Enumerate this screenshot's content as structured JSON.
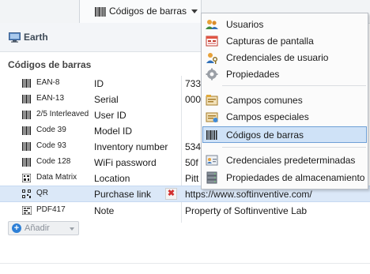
{
  "tab": {
    "label": "Códigos de barras"
  },
  "left_panel": {
    "computer_name": "Earth",
    "grid_title": "Códigos de barras",
    "add_button_label": "Añadir",
    "rows": [
      {
        "type": "EAN-8",
        "name": "ID",
        "value": "733",
        "selected": false
      },
      {
        "type": "EAN-13",
        "name": "Serial",
        "value": "000",
        "selected": false
      },
      {
        "type": "2/5 Interleaved",
        "name": "User ID",
        "value": "",
        "selected": false
      },
      {
        "type": "Code 39",
        "name": "Model ID",
        "value": "",
        "selected": false
      },
      {
        "type": "Code 93",
        "name": "Inventory number",
        "value": "534",
        "selected": false
      },
      {
        "type": "Code 128",
        "name": "WiFi password",
        "value": "50f",
        "selected": false
      },
      {
        "type": "Data Matrix",
        "name": "Location",
        "value": "Pitt",
        "selected": false
      },
      {
        "type": "QR",
        "name": "Purchase link",
        "value": "https://www.softinventive.com/",
        "selected": true
      },
      {
        "type": "PDF417",
        "name": "Note",
        "value": "Property of Softinventive Lab",
        "selected": false
      }
    ]
  },
  "menu": {
    "items": [
      {
        "label": "Usuarios",
        "icon": "users-icon"
      },
      {
        "label": "Capturas de pantalla",
        "icon": "screenshot-icon"
      },
      {
        "label": "Credenciales de usuario",
        "icon": "user-key-icon"
      },
      {
        "label": "Propiedades",
        "icon": "gear-icon"
      },
      {
        "label": "Campos comunes",
        "icon": "common-fields-icon"
      },
      {
        "label": "Campos especiales",
        "icon": "special-fields-icon"
      },
      {
        "label": "Códigos de barras",
        "icon": "barcode-icon",
        "active": true
      },
      {
        "label": "Credenciales predeterminadas",
        "icon": "default-credentials-icon"
      },
      {
        "label": "Propiedades de almacenamiento",
        "icon": "storage-icon"
      }
    ]
  },
  "colors": {
    "selection": "#dbe8f8",
    "menu_active": "#cfe2f7",
    "accent": "#2d7fd6",
    "delete": "#d23030"
  }
}
